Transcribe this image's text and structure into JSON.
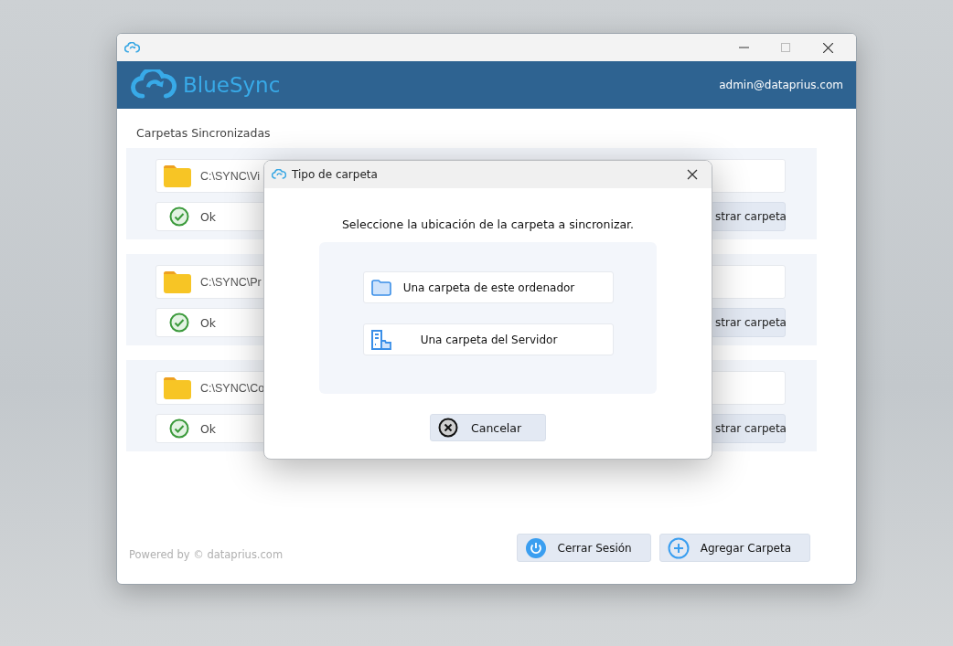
{
  "header": {
    "logo_text": "BlueSync",
    "user": "admin@dataprius.com"
  },
  "section_title": "Carpetas Sincronizadas",
  "folders": [
    {
      "path": "C:\\SYNC\\Vi",
      "status": "Ok",
      "button": "strar carpeta"
    },
    {
      "path": "C:\\SYNC\\Pr",
      "status": "Ok",
      "button": "strar carpeta"
    },
    {
      "path": "C:\\SYNC\\Co",
      "status": "Ok",
      "button": "strar carpeta"
    }
  ],
  "footer": {
    "powered_by": "Powered by © dataprius.com",
    "buttons": [
      {
        "label": "Cerrar Sesión",
        "kind": "power"
      },
      {
        "label": "Agregar Carpeta",
        "kind": "add"
      }
    ]
  },
  "dialog": {
    "title": "Tipo de carpeta",
    "prompt": "Seleccione la ubicación de la carpeta a sincronizar.",
    "options": [
      {
        "label": "Una carpeta de este ordenador",
        "kind": "local"
      },
      {
        "label": "Una carpeta del Servidor",
        "kind": "server"
      }
    ],
    "cancel": "Cancelar"
  }
}
